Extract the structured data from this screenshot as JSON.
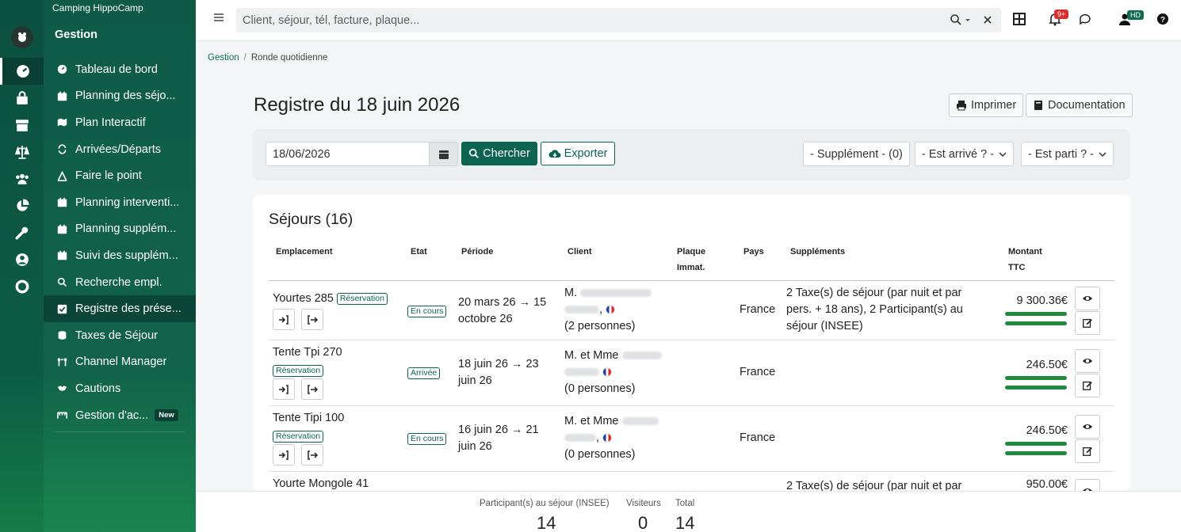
{
  "sidebar": {
    "camping_name": "Camping HippoCamp",
    "section_title": "Gestion",
    "items": [
      {
        "label": "Tableau de bord",
        "icon": "gauge-icon"
      },
      {
        "label": "Planning des séjo...",
        "icon": "calendar-icon"
      },
      {
        "label": "Plan Interactif",
        "icon": "map-icon"
      },
      {
        "label": "Arrivées/Départs",
        "icon": "arrows-rotate-icon"
      },
      {
        "label": "Faire le point",
        "icon": "drafting-icon"
      },
      {
        "label": "Planning interventi...",
        "icon": "calendar-icon"
      },
      {
        "label": "Planning supplém...",
        "icon": "calendar-icon"
      },
      {
        "label": "Suivi des supplém...",
        "icon": "calendar-icon"
      },
      {
        "label": "Recherche empl.",
        "icon": "search-icon"
      },
      {
        "label": "Registre des prése...",
        "icon": "checkbox-icon",
        "active": true
      },
      {
        "label": "Taxes de Séjour",
        "icon": "coins-icon"
      },
      {
        "label": "Channel Manager",
        "icon": "sitemap-icon"
      },
      {
        "label": "Cautions",
        "icon": "handshake-icon"
      },
      {
        "label": "Gestion d'ac...",
        "icon": "barrier-icon",
        "badge": "New"
      }
    ]
  },
  "topbar": {
    "search_placeholder": "Client, séjour, tél, facture, plaque...",
    "notifications_badge": "9+",
    "user_initials": "HD"
  },
  "breadcrumb": {
    "root": "Gestion",
    "current": "Ronde quotidienne"
  },
  "page": {
    "title": "Registre du 18 juin 2026",
    "print_label": "Imprimer",
    "doc_label": "Documentation"
  },
  "filters": {
    "date": "18/06/2026",
    "search_label": "Chercher",
    "export_label": "Exporter",
    "supplement": "- Supplément - (0)",
    "arrived": "- Est arrivé ? -",
    "departed": "- Est parti ? -"
  },
  "sejours": {
    "title": "Séjours (16)",
    "headers": {
      "emplacement": "Emplacement",
      "etat": "Etat",
      "periode": "Période",
      "client": "Client",
      "plaque1": "Plaque",
      "plaque2": "Immat.",
      "pays": "Pays",
      "supplements": "Suppléments",
      "montant1": "Montant",
      "montant2": "TTC"
    },
    "rows": [
      {
        "emplacement": "Yourtes 285",
        "reservation": "Réservation",
        "etat": "En cours",
        "periode1": "20 mars 26 → 15",
        "periode2": "octobre 26",
        "client_prefix": "M.",
        "personnes": "(2 personnes)",
        "pays": "France",
        "supp1": "2 Taxe(s) de séjour (par nuit et par",
        "supp2": "pers. + 18 ans), 2 Participant(s) au",
        "supp3": "séjour (INSEE)",
        "montant": "9 300.36€"
      },
      {
        "emplacement": "Tente Tpi 270",
        "reservation": "Réservation",
        "etat": "Arrivée",
        "periode1": "18 juin 26 → 23",
        "periode2": "juin 26",
        "client_prefix": "M. et Mme",
        "personnes": "(0 personnes)",
        "pays": "France",
        "montant": "246.50€"
      },
      {
        "emplacement": "Tente Tipi 100",
        "reservation": "Réservation",
        "etat": "En cours",
        "periode1": "16 juin 26 → 21",
        "periode2": "juin 26",
        "client_prefix": "M. et Mme",
        "personnes": "(0 personnes)",
        "pays": "France",
        "montant": "246.50€"
      },
      {
        "emplacement": "Yourte Mongole 41",
        "supp1": "2 Taxe(s) de séjour (par nuit et par",
        "montant": "950.00€"
      }
    ]
  },
  "footer": {
    "participants_label": "Participant(s) au séjour (INSEE)",
    "participants_value": "14",
    "visiteurs_label": "Visiteurs",
    "visiteurs_value": "0",
    "total_label": "Total",
    "total_value": "14"
  },
  "colors": {
    "brand": "#0c6350",
    "sidebar": "#0e5a47",
    "progress": "#1e8a3e",
    "alert": "#d9302f"
  }
}
